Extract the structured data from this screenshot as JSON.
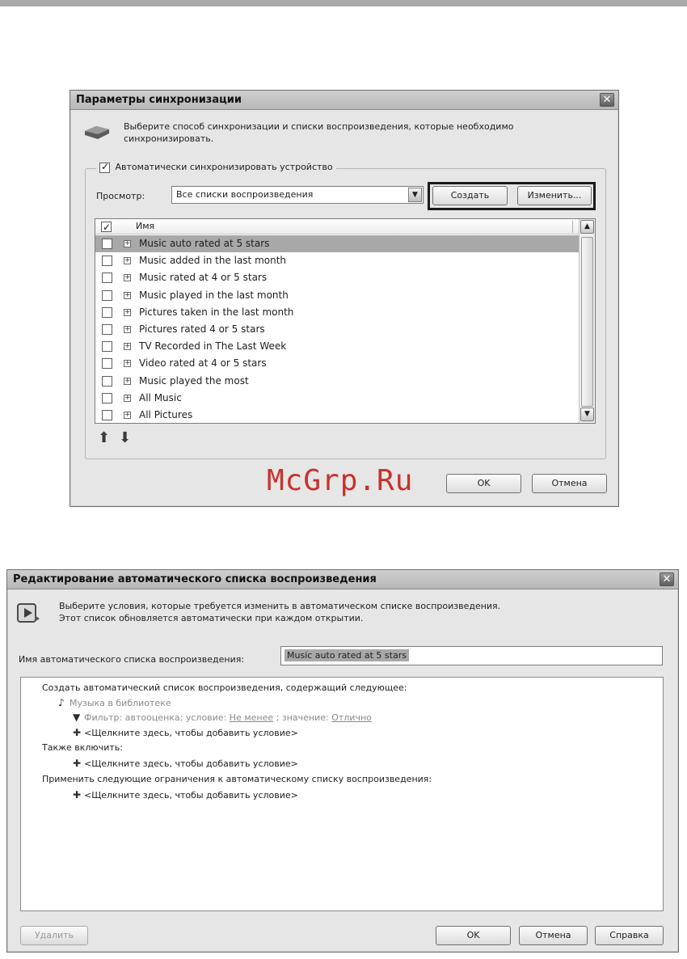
{
  "dialog1": {
    "title": "Параметры синхронизации",
    "description": "Выберите способ синхронизации и списки воспроизведения, которые необходимо синхронизировать.",
    "auto_sync_label": "Автоматически синхронизировать устройство",
    "auto_sync_checked": true,
    "view_label": "Просмотр:",
    "view_value": "Все списки воспроизведения",
    "create_button": "Создать",
    "edit_button": "Изменить...",
    "list_header": "Имя",
    "items": [
      {
        "label": "Music auto rated at 5 stars",
        "selected": true
      },
      {
        "label": "Music added in the last month",
        "selected": false
      },
      {
        "label": "Music rated at 4 or 5 stars",
        "selected": false
      },
      {
        "label": "Music played in the last month",
        "selected": false
      },
      {
        "label": "Pictures taken in the last month",
        "selected": false
      },
      {
        "label": "Pictures rated 4 or 5 stars",
        "selected": false
      },
      {
        "label": "TV Recorded in The Last Week",
        "selected": false
      },
      {
        "label": "Video rated at 4 or 5 stars",
        "selected": false
      },
      {
        "label": "Music played the most",
        "selected": false
      },
      {
        "label": "All Music",
        "selected": false
      },
      {
        "label": "All Pictures",
        "selected": false
      }
    ],
    "ok_button": "OK",
    "cancel_button": "Отмена",
    "watermark": "McGrp.Ru"
  },
  "dialog2": {
    "title": "Редактирование автоматического списка воспроизведения",
    "description_line1": "Выберите условия, которые требуется изменить в автоматическом списке воспроизведения.",
    "description_line2": "Этот список обновляется автоматически при каждом открытии.",
    "name_label": "Имя автоматического списка воспроизведения:",
    "name_value": "Music auto rated at 5 stars",
    "create_heading": "Создать автоматический список воспроизведения, содержащий следующее:",
    "library_item": "Музыка в библиотеке",
    "filter_prefix": "Фильтр: автооценка; условие:",
    "filter_condition": "Не менее",
    "filter_value_prefix": "; значение:",
    "filter_value": "Отлично",
    "add_condition": "<Щелкните здесь, чтобы добавить условие>",
    "also_include": "Также включить:",
    "apply_limits": "Применить следующие ограничения к автоматическому списку воспроизведения:",
    "delete_button": "Удалить",
    "ok_button": "OK",
    "cancel_button": "Отмена",
    "help_button": "Справка"
  }
}
